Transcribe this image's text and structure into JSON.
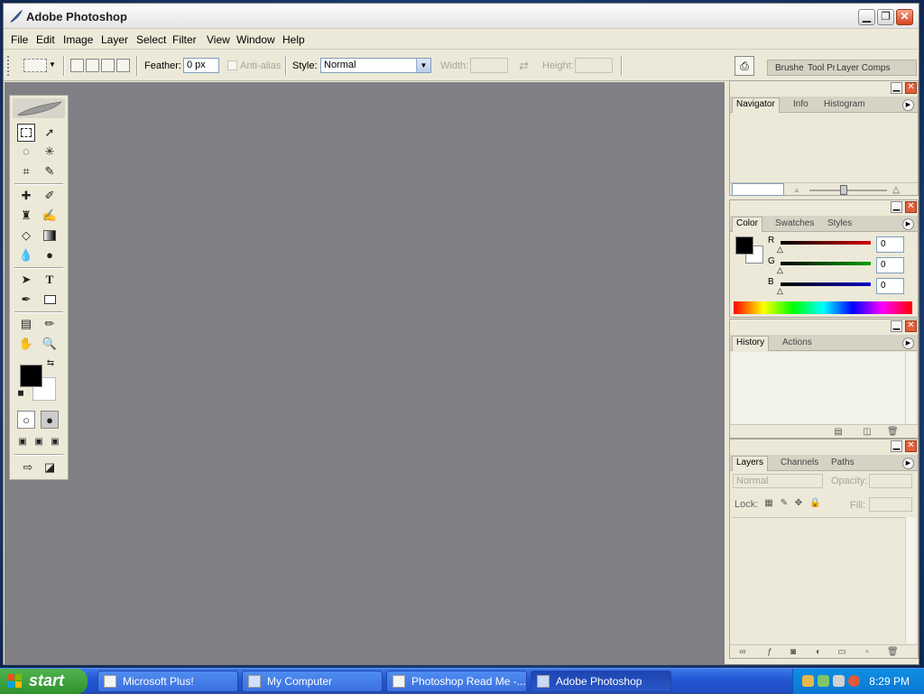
{
  "window": {
    "title": "Adobe Photoshop",
    "minimize": "▁",
    "maximize": "❐",
    "close": "✕"
  },
  "menu": [
    "File",
    "Edit",
    "Image",
    "Layer",
    "Select",
    "Filter",
    "View",
    "Window",
    "Help"
  ],
  "options": {
    "feather_label": "Feather:",
    "feather_value": "0 px",
    "antialias_label": "Anti-alias",
    "style_label": "Style:",
    "style_value": "Normal",
    "width_label": "Width:",
    "height_label": "Height:",
    "well_tabs": [
      "Brushes",
      "Tool Presets",
      "Layer Comps"
    ]
  },
  "panels": {
    "navigator": {
      "tabs": [
        "Navigator",
        "Info",
        "Histogram"
      ]
    },
    "color": {
      "tabs": [
        "Color",
        "Swatches",
        "Styles"
      ],
      "r_label": "R",
      "g_label": "G",
      "b_label": "B",
      "r_value": "0",
      "g_value": "0",
      "b_value": "0",
      "colors": {
        "r": "#d10000",
        "g": "#00a000",
        "b": "#0000c8"
      }
    },
    "history": {
      "tabs": [
        "History",
        "Actions"
      ]
    },
    "layers": {
      "tabs": [
        "Layers",
        "Channels",
        "Paths"
      ],
      "blend_mode": "Normal",
      "opacity_label": "Opacity:",
      "lock_label": "Lock:",
      "fill_label": "Fill:"
    }
  },
  "taskbar": {
    "start_label": "start",
    "tasks": [
      "Microsoft Plus!",
      "My Computer",
      "Photoshop Read Me -...",
      "Adobe Photoshop"
    ],
    "clock": "8:29 PM"
  }
}
